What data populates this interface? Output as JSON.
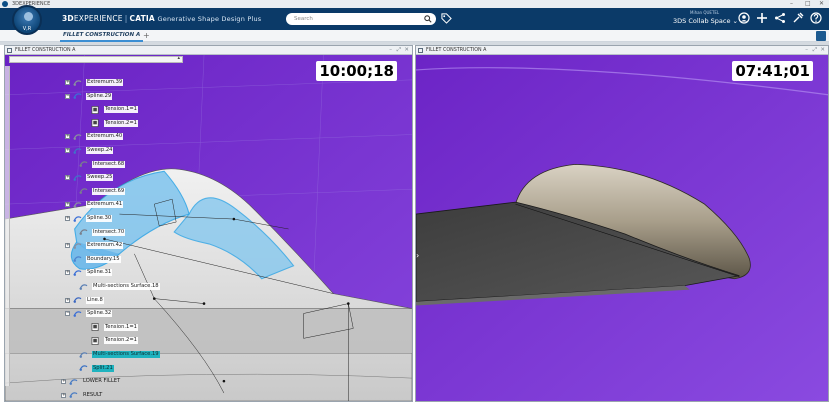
{
  "window": {
    "title": "3DEXPERIENCE",
    "controls": [
      "–",
      "□",
      "✕"
    ]
  },
  "topbar": {
    "compass_label": "V,R",
    "brand_3d": "3D",
    "brand_experience": "EXPERIENCE",
    "brand_sep": "|",
    "brand_product": "CATIA",
    "brand_module": "Generative Shape Design Plus",
    "search_placeholder": "Search",
    "user_name": "Mihan QUETEL",
    "collab_space": "3DS Collab Space ⌄",
    "icons": [
      "user-icon",
      "add-icon",
      "share-icon",
      "tools-icon",
      "help-icon"
    ]
  },
  "tabs": {
    "active": "FILLET CONSTRUCTION A",
    "add": "+"
  },
  "viewers": {
    "left": {
      "title": "FILLET CONSTRUCTION A",
      "timer": "10:00;18",
      "controls": [
        "–",
        "⤢",
        "✕"
      ]
    },
    "right": {
      "title": "FILLET CONSTRUCTION A",
      "timer": "07:41;01",
      "controls": [
        "–",
        "⤢",
        "✕"
      ]
    }
  },
  "tree": {
    "nodes": [
      {
        "label": "Extremum.39",
        "icon": "point-icon",
        "expander": "+"
      },
      {
        "label": "Spline.29",
        "icon": "spline-icon",
        "expander": "−"
      },
      {
        "label": "Tension.1=1",
        "icon": "tension-icon",
        "expander": ""
      },
      {
        "label": "Tension.2=1",
        "icon": "tension-icon",
        "expander": ""
      },
      {
        "label": "Extremum.40",
        "icon": "point-icon",
        "expander": "+"
      },
      {
        "label": "Sweep.24",
        "icon": "sweep-icon",
        "expander": "+"
      },
      {
        "label": "Intersect.68",
        "icon": "intersect-icon",
        "expander": ""
      },
      {
        "label": "Sweep.25",
        "icon": "sweep-icon",
        "expander": "+"
      },
      {
        "label": "Intersect.69",
        "icon": "intersect-icon",
        "expander": ""
      },
      {
        "label": "Extremum.41",
        "icon": "point-icon",
        "expander": "+"
      },
      {
        "label": "Spline.30",
        "icon": "spline-icon",
        "expander": "+"
      },
      {
        "label": "Intersect.70",
        "icon": "intersect-icon",
        "expander": ""
      },
      {
        "label": "Extremum.42",
        "icon": "point-icon",
        "expander": "+"
      },
      {
        "label": "Boundary.15",
        "icon": "boundary-icon",
        "expander": ""
      },
      {
        "label": "Spline.31",
        "icon": "spline-icon",
        "expander": "+"
      },
      {
        "label": "Multi-sections Surface.18",
        "icon": "multisection-icon",
        "expander": ""
      },
      {
        "label": "Line.8",
        "icon": "line-icon",
        "expander": "+"
      },
      {
        "label": "Spline.32",
        "icon": "spline-icon",
        "expander": "−"
      },
      {
        "label": "Tension.1=1",
        "icon": "tension-icon",
        "expander": ""
      },
      {
        "label": "Tension.2=1",
        "icon": "tension-icon",
        "expander": ""
      },
      {
        "label": "Multi-sections Surface.19",
        "icon": "multisection-icon",
        "expander": "",
        "selected": true
      },
      {
        "label": "Split.21",
        "icon": "split-icon",
        "expander": "",
        "selected": true
      },
      {
        "label": "LOWER FILLET",
        "icon": "geoset-icon",
        "expander": "+",
        "plain": true
      },
      {
        "label": "RESULT",
        "icon": "geoset-icon",
        "expander": "+",
        "plain": true
      }
    ]
  },
  "colors": {
    "topbar": "#0b3a68",
    "background_purple": "#7a3ad2",
    "selection": "#1fb3bf",
    "surface_highlight": "#7fc4ee"
  }
}
